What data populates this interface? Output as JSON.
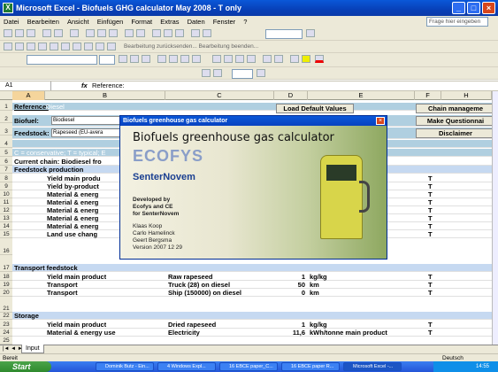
{
  "window": {
    "title": "Microsoft Excel - Biofuels GHG calculator May 2008 - T only"
  },
  "menu": [
    "Datei",
    "Bearbeiten",
    "Ansicht",
    "Einfügen",
    "Format",
    "Extras",
    "Daten",
    "Fenster",
    "?"
  ],
  "help_placeholder": "Frage hier eingeben",
  "toolbar": {
    "review_text": "Bearbeitung zurücksenden...   Bearbeitung beenden..."
  },
  "formula_bar": {
    "cell_ref": "A1",
    "fx": "fx",
    "content": "Reference:"
  },
  "columns": [
    "A",
    "B",
    "C",
    "D",
    "E",
    "F",
    "H"
  ],
  "sheet": {
    "reference_label": "Reference:",
    "reference_value": "Diesel",
    "biofuel_label": "Biofuel:",
    "biofuel_value": "Biodiesel",
    "feedstock_label": "Feedstock:",
    "feedstock_value": "Rapeseed (EU-avera",
    "load_button": "Load Default Values",
    "chain_button": "Chain manageme",
    "questionnaire_button": "Make Questionnai",
    "disclaimer_button": "Disclaimer",
    "conservative_note": "C = conservative; T = typical; E",
    "current_chain": "Current chain: Biodiesel fro",
    "feedstock_production": "Feedstock production",
    "transport_feedstock": "Transport feedstock",
    "storage": "Storage"
  },
  "rows": [
    {
      "n": "1"
    },
    {
      "n": "2"
    },
    {
      "n": "3"
    },
    {
      "n": "4"
    },
    {
      "n": "5"
    },
    {
      "n": "6"
    },
    {
      "n": "7"
    },
    {
      "n": "8",
      "b": "Yield main produ",
      "f": "T"
    },
    {
      "n": "9",
      "b": "Yield by-product",
      "f": "T"
    },
    {
      "n": "10",
      "b": "Material & energ",
      "f": "T"
    },
    {
      "n": "11",
      "b": "Material & energ",
      "f": "T"
    },
    {
      "n": "12",
      "b": "Material & energ",
      "f": "T"
    },
    {
      "n": "13",
      "b": "Material & energ",
      "f": "T"
    },
    {
      "n": "14",
      "b": "Material & energ",
      "f": "T"
    },
    {
      "n": "15",
      "b": "Land use chang",
      "f": "T"
    },
    {
      "n": "16"
    },
    {
      "n": "17"
    },
    {
      "n": "18",
      "b": "Yield main product",
      "c": "Raw rapeseed",
      "d": "1",
      "e": "kg/kg",
      "f": "T"
    },
    {
      "n": "19",
      "b": "Transport",
      "c": "Truck (28) on diesel",
      "d": "50",
      "e": "km",
      "f": "T"
    },
    {
      "n": "20",
      "b": "Transport",
      "c": "Ship (150000) on diesel",
      "d": "0",
      "e": "km",
      "f": "T"
    },
    {
      "n": "21"
    },
    {
      "n": "22"
    },
    {
      "n": "23",
      "b": "Yield main product",
      "c": "Dried rapeseed",
      "d": "1",
      "e": "kg/kg",
      "f": "T"
    },
    {
      "n": "24",
      "b": "Material & energy use",
      "c": "Electricity",
      "d": "11,6",
      "e": "kWh/tonne main product",
      "f": "T"
    },
    {
      "n": "25"
    }
  ],
  "splash": {
    "caption": "Biofuels greenhouse gas calculator",
    "title": "Biofuels greenhouse gas calculator",
    "ecofys": "ECOFYS",
    "senternovem": "SenterNovem",
    "developed": [
      "Developed by",
      "Ecofys and CE",
      "for SenterNovem"
    ],
    "authors": [
      "Klaas Koop",
      "Carlo Hamelinck",
      "Geert Bergsma",
      "Version 2007 12 29"
    ]
  },
  "sheet_tab": "Input",
  "status": {
    "left": "Bereit",
    "right": "Deutsch (Deutschland)"
  },
  "taskbar": {
    "start": "Start",
    "tasks": [
      "Dominik Butz - Ein...",
      "4 Windows Expl...",
      "16 EBCE paper_C...",
      "16 EBCE paper R...",
      "Microsoft Excel -..."
    ],
    "clock": "14:55"
  }
}
